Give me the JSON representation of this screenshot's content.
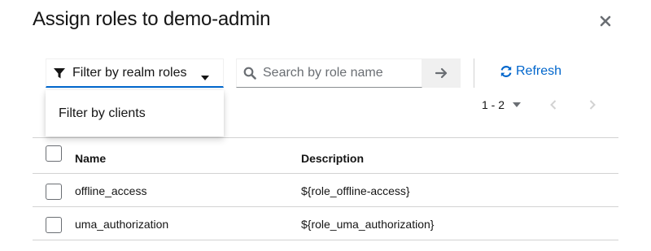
{
  "modal": {
    "title": "Assign roles to demo-admin"
  },
  "toolbar": {
    "filter_label": "Filter by realm roles",
    "search_placeholder": "Search by role name",
    "refresh_label": "Refresh"
  },
  "filter_menu": {
    "items": [
      "Filter by clients"
    ]
  },
  "pagination": {
    "range": "1 - 2"
  },
  "table": {
    "columns": [
      "Name",
      "Description"
    ],
    "rows": [
      {
        "name": "offline_access",
        "description": "${role_offline-access}"
      },
      {
        "name": "uma_authorization",
        "description": "${role_uma_authorization}"
      }
    ]
  },
  "colors": {
    "accent": "#0066cc",
    "text": "#151515",
    "border": "#d2d2d2",
    "muted": "#6a6e73"
  },
  "icons": {
    "close": "close-icon",
    "filter": "filter-icon",
    "caret": "caret-down-icon",
    "search": "search-icon",
    "submit": "arrow-right-icon",
    "refresh": "sync-icon",
    "prev": "angle-left-icon",
    "next": "angle-right-icon"
  }
}
